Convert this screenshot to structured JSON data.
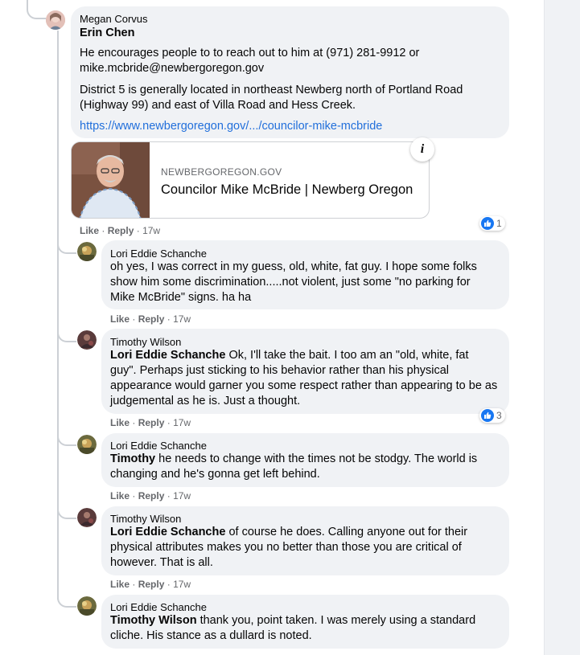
{
  "top_comment": {
    "author": "Megan Corvus",
    "mention": "Erin Chen",
    "paragraph1": "He encourages people to to reach out to him at (971) 281-9912 or mike.mcbride@newbergoregon.gov",
    "paragraph2": "District 5 is generally located in northeast Newberg north of Portland Road (Highway 99) and east of Villa Road and Hess Creek.",
    "link_text": "https://www.newbergoregon.gov/.../councilor-mike-mcbride",
    "link_card": {
      "domain": "NEWBERGOREGON.GOV",
      "title": "Councilor Mike McBride | Newberg Oregon",
      "info_icon": "info-icon"
    },
    "actions": {
      "like": "Like",
      "reply": "Reply",
      "sep": "·",
      "time": "17w"
    },
    "reactions": {
      "icon": "thumbs-up-icon",
      "count": "1"
    }
  },
  "replies": [
    {
      "author": "Lori Eddie Schanche",
      "mention": "",
      "text": "oh yes, I was correct in my guess, old, white, fat guy. I hope some folks show him some discrimination.....not violent, just some \"no parking for Mike McBride\" signs. ha ha",
      "actions": {
        "like": "Like",
        "reply": "Reply",
        "time": "17w"
      }
    },
    {
      "author": "Timothy Wilson",
      "mention": "Lori Eddie Schanche",
      "text": " Ok, I'll take the bait. I too am an \"old, white, fat guy\". Perhaps just sticking to his behavior rather than his physical appearance would garner you some respect rather than appearing to be as judgemental as he is. Just a thought.",
      "actions": {
        "like": "Like",
        "reply": "Reply",
        "time": "17w"
      },
      "reactions": {
        "icon": "thumbs-up-icon",
        "count": "3"
      }
    },
    {
      "author": "Lori Eddie Schanche",
      "mention": "Timothy",
      "text": " he needs to change with the times not be stodgy. The world is changing and he's gonna get left behind.",
      "actions": {
        "like": "Like",
        "reply": "Reply",
        "time": "17w"
      }
    },
    {
      "author": "Timothy Wilson",
      "mention": "Lori Eddie Schanche",
      "text": " of course he does. Calling anyone out for their physical attributes makes you no better than those you are critical of however. That is all.",
      "actions": {
        "like": "Like",
        "reply": "Reply",
        "time": "17w"
      }
    },
    {
      "author": "Lori Eddie Schanche",
      "mention": "Timothy Wilson",
      "text": " thank you, point taken. I was merely using a standard cliche. His stance as a dullard is noted.",
      "actions": {
        "like": "Like",
        "reply": "Reply",
        "time": "17w"
      }
    }
  ],
  "colors": {
    "bubble": "#f0f2f5",
    "link": "#216fdb",
    "meta": "#65676b",
    "like_blue": "#1877f2"
  }
}
